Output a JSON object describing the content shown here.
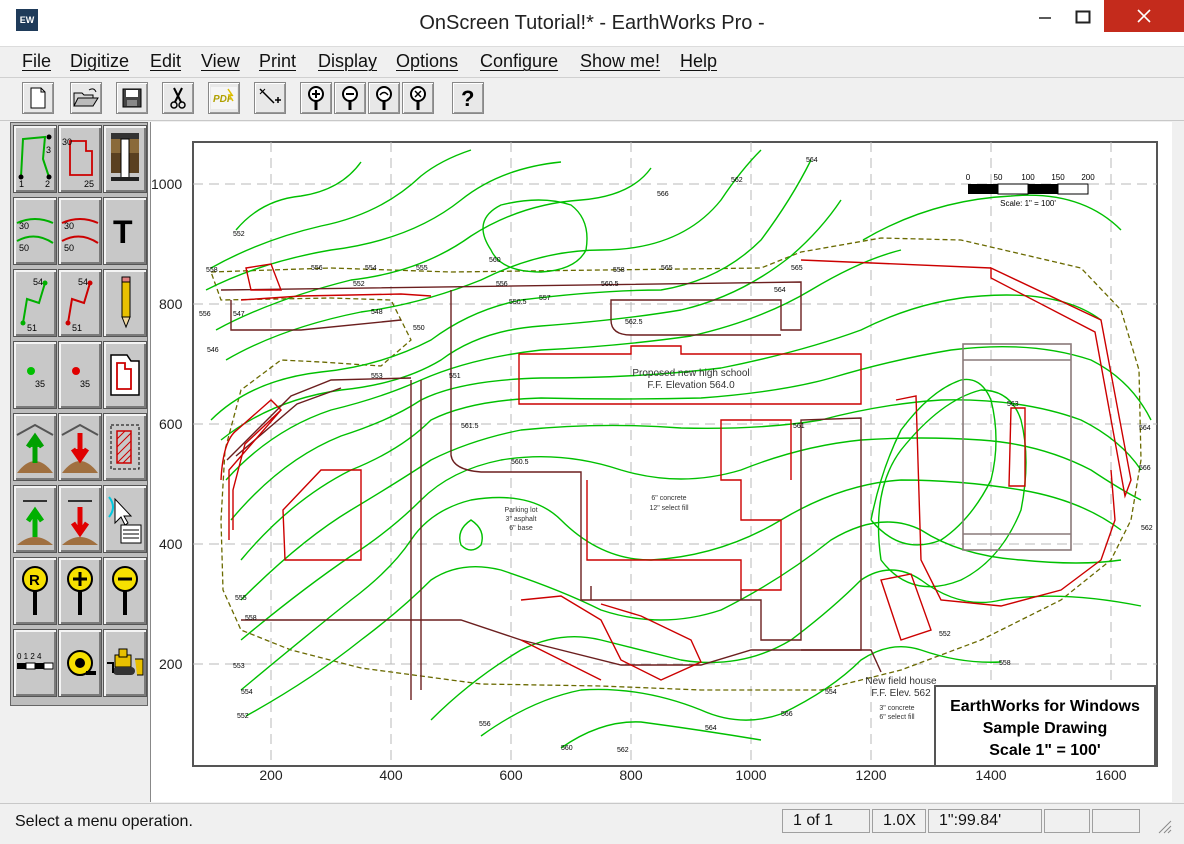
{
  "window": {
    "app_icon_text": "EW",
    "title": "OnScreen Tutorial!* - EarthWorks Pro -"
  },
  "menu": [
    {
      "label": "File"
    },
    {
      "label": "Digitize"
    },
    {
      "label": "Edit"
    },
    {
      "label": "View"
    },
    {
      "label": "Print"
    },
    {
      "label": "Display"
    },
    {
      "label": "Options"
    },
    {
      "label": "Configure"
    },
    {
      "label": "Show me!"
    },
    {
      "label": "Help"
    }
  ],
  "toolbar": {
    "icons": [
      "new-file-icon",
      "open-folder-icon",
      "save-disk-icon",
      "scissors-icon",
      "pdf-icon",
      "add-point-icon",
      "zoom-in-icon",
      "zoom-out-icon",
      "zoom-window-icon",
      "zoom-all-icon",
      "help-question-icon"
    ],
    "pdf_label": "PDF"
  },
  "palette": {
    "icons": [
      "digitize-points-icon",
      "digitize-polygon-icon",
      "soil-boring-icon",
      "contour-lines-icon",
      "contour-edit-icon",
      "text-tool-icon",
      "polyline-connect-icon",
      "polyline-red-icon",
      "pencil-icon",
      "green-point-icon",
      "red-point-icon",
      "area-outline-icon",
      "fill-up-icon",
      "cut-down-icon",
      "hatched-area-icon",
      "raise-surface-icon",
      "lower-surface-icon",
      "select-properties-icon",
      "zoom-redraw-icon",
      "zoom-in-icon",
      "zoom-out-icon",
      "scale-bar-icon",
      "measure-icon",
      "bulldozer-icon"
    ],
    "labels": {
      "t30": "30",
      "t3": "3",
      "t1": "1",
      "t2": "2",
      "t25": "25",
      "t50": "50",
      "t54": "54",
      "t51": "51",
      "t35": "35",
      "text_tool": "T",
      "scale": "0 1 2 4",
      "zoom_r": "R"
    }
  },
  "drawing": {
    "axis_y": [
      "1000",
      "800",
      "600",
      "400",
      "200"
    ],
    "axis_x": [
      "200",
      "400",
      "600",
      "800",
      "1000",
      "1200",
      "1400",
      "1600"
    ],
    "scalebar_ticks": [
      "0",
      "50",
      "100",
      "150",
      "200"
    ],
    "scalebar_caption": "Scale: 1\" = 100'",
    "label_school": "Proposed new high school",
    "label_school_elev": "F.F. Elevation 564.0",
    "label_concrete": "6\" concrete",
    "label_fill": "12\" select fill",
    "label_parking": "Parking lot",
    "label_asphalt": "3\" asphalt",
    "label_base": "6\" base",
    "label_fieldhouse": "New field house",
    "label_fieldhouse_elev": "F.F. Elev. 562",
    "label_fh_concrete": "3\" concrete",
    "label_fh_fill": "6\" select fill",
    "title_block_1": "EarthWorks for Windows",
    "title_block_2": "Sample Drawing",
    "title_block_3": "Scale 1\" = 100'",
    "contour_labels": [
      "564",
      "562",
      "566",
      "552",
      "560",
      "558",
      "555",
      "556",
      "554",
      "558",
      "550",
      "546",
      "556",
      "561.5",
      "560.5",
      "552",
      "556",
      "557",
      "562.5",
      "564",
      "565",
      "548",
      "547",
      "560.5",
      "550.5",
      "551",
      "553",
      "565",
      "563",
      "561",
      "555",
      "558",
      "553",
      "562",
      "566",
      "564",
      "552",
      "554",
      "556",
      "558",
      "560",
      "562",
      "564",
      "566",
      "554",
      "552"
    ]
  },
  "statusbar": {
    "message": "Select a menu operation.",
    "page": "1 of 1",
    "zoom": "1.0X",
    "scale": "1\":99.84'"
  },
  "colors": {
    "contour": "#00c000",
    "proposed": "#cc0000",
    "existing": "#6b1f1f",
    "boundary": "#8a8a00",
    "close_button": "#c42b1c"
  }
}
